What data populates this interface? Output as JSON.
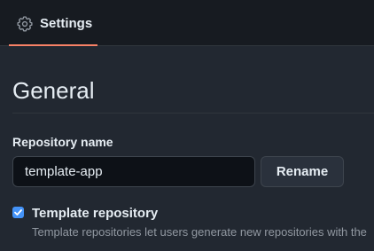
{
  "header": {
    "tab": {
      "label": "Settings",
      "icon": "gear-icon",
      "active_underline_color": "#f78166"
    }
  },
  "main": {
    "section_title": "General",
    "repository_name": {
      "label": "Repository name",
      "value": "template-app",
      "rename_button": "Rename"
    },
    "template_repository": {
      "checked": true,
      "label": "Template repository",
      "description": "Template repositories let users generate new repositories with the",
      "checkbox_color": "#4493f8"
    }
  }
}
